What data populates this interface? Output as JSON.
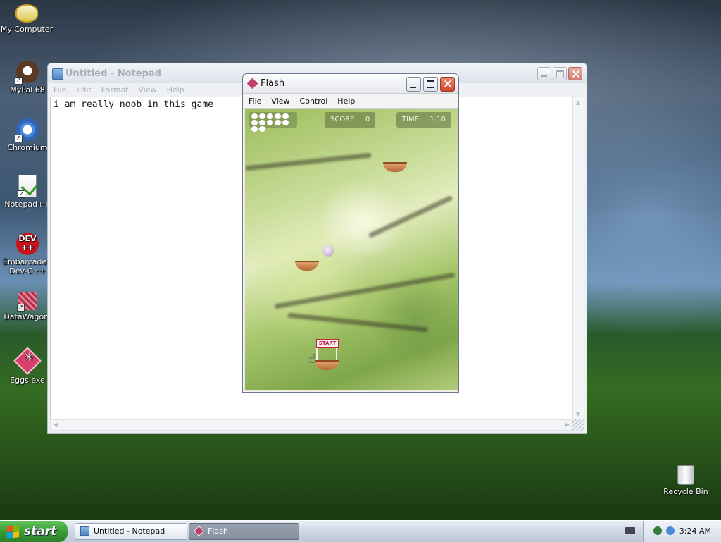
{
  "desktop": {
    "icons": [
      {
        "label": "My Computer",
        "icon": "my-computer-icon"
      },
      {
        "label": "MyPal 68",
        "icon": "mypal-icon"
      },
      {
        "label": "Chromium",
        "icon": "chromium-icon"
      },
      {
        "label": "Notepad++",
        "icon": "notepadpp-icon"
      },
      {
        "label": "Embarcadero Dev-C++",
        "icon": "devcpp-icon",
        "badge": "DEV\n++"
      },
      {
        "label": "DataWagon.",
        "icon": "datawagon-icon"
      },
      {
        "label": "Eggs.exe",
        "icon": "eggs-exe-icon"
      },
      {
        "label": "Recycle Bin",
        "icon": "recycle-bin-icon"
      }
    ]
  },
  "notepad": {
    "title": "Untitled - Notepad",
    "menu": [
      "File",
      "Edit",
      "Format",
      "View",
      "Help"
    ],
    "content": "i am really noob in this game"
  },
  "flash": {
    "title": "Flash",
    "menu": [
      "File",
      "View",
      "Control",
      "Help"
    ],
    "game": {
      "score_label": "SCORE:",
      "score_value": "0",
      "time_label": "TIME:",
      "time_value": "1:10",
      "eggs_remaining": 12,
      "start_label": "START"
    }
  },
  "taskbar": {
    "start_label": "start",
    "tasks": [
      {
        "label": "Untitled - Notepad",
        "icon": "notepad-icon",
        "active": false
      },
      {
        "label": "Flash",
        "icon": "flash-icon",
        "active": true
      }
    ],
    "clock": "3:24 AM"
  },
  "colors": {
    "start_green": "#379a32",
    "close_red": "#d0452a",
    "egg_pink": "#d8406a"
  }
}
